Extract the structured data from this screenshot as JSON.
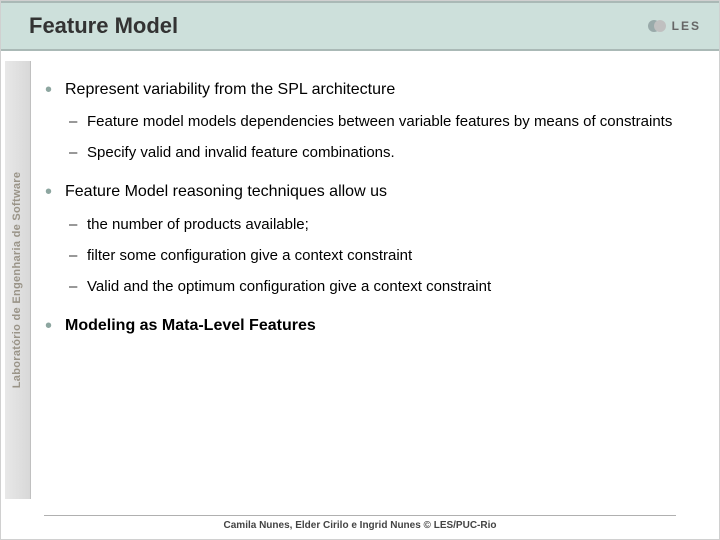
{
  "header": {
    "title": "Feature Model",
    "logo_text": "LES"
  },
  "sidebar": {
    "label": "Laboratório de Engenharia de Software"
  },
  "content": {
    "b1": {
      "text": "Represent variability from the SPL architecture",
      "sub1": "Feature model models dependencies between variable features by means of constraints",
      "sub2": "Specify valid and invalid feature combinations."
    },
    "b2": {
      "text": "Feature Model reasoning techniques allow us",
      "sub1": "the number of products available;",
      "sub2": "filter some configuration give a context constraint",
      "sub3": "Valid and the optimum configuration give a context constraint"
    },
    "b3": {
      "text": "Modeling as Mata-Level Features"
    }
  },
  "footer": {
    "text": "Camila Nunes, Elder Cirilo e Ingrid Nunes © LES/PUC-Rio"
  }
}
